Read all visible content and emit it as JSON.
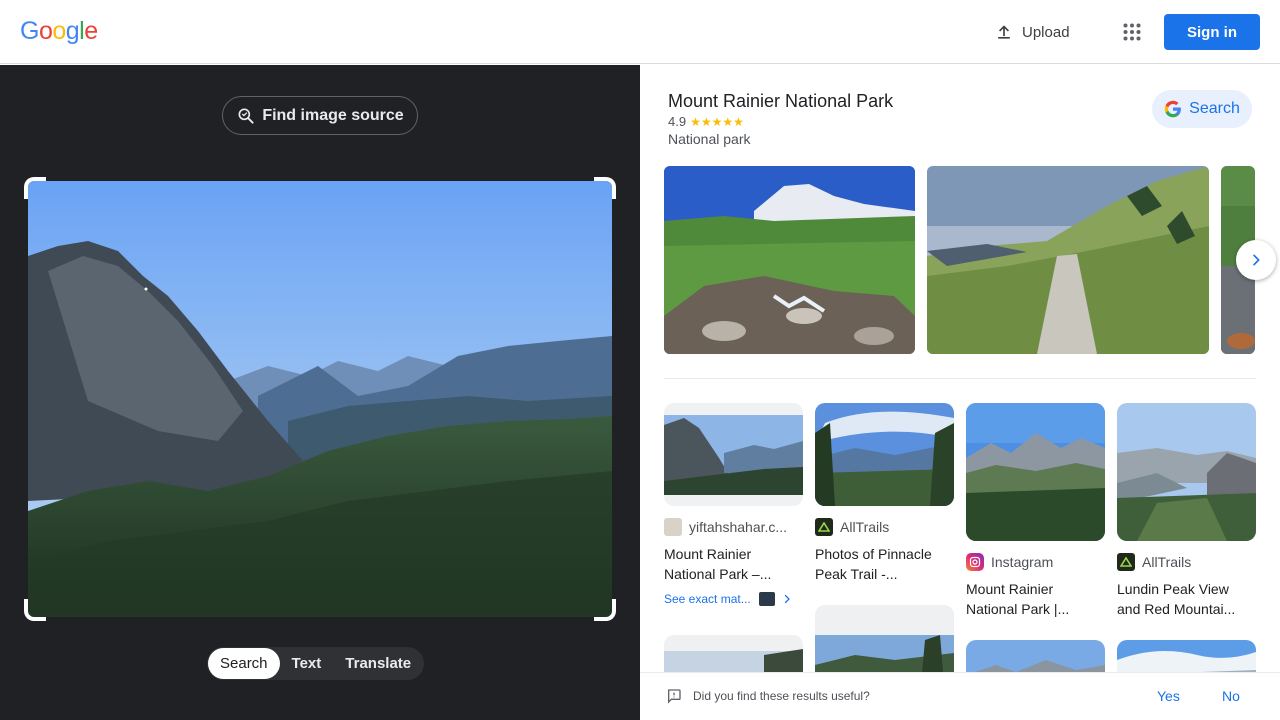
{
  "header": {
    "logo_letters": [
      {
        "ch": "G",
        "color": "#4285f4"
      },
      {
        "ch": "o",
        "color": "#ea4335"
      },
      {
        "ch": "o",
        "color": "#fbbc05"
      },
      {
        "ch": "g",
        "color": "#4285f4"
      },
      {
        "ch": "l",
        "color": "#34a853"
      },
      {
        "ch": "e",
        "color": "#ea4335"
      }
    ],
    "upload_label": "Upload",
    "apps_icon": "apps-grid-icon",
    "signin_label": "Sign in",
    "accent": "#1a73e8"
  },
  "left_panel": {
    "find_source_label": "Find image source",
    "modes": [
      {
        "label": "Search",
        "active": true
      },
      {
        "label": "Text",
        "active": false
      },
      {
        "label": "Translate",
        "active": false
      }
    ]
  },
  "knowledge_panel": {
    "title": "Mount Rainier National Park",
    "rating": "4.9",
    "stars": "★★★★★",
    "type": "National park",
    "search_label": "Search"
  },
  "results": [
    {
      "source": "yiftahshahar.c...",
      "title": "Mount Rainier National Park –...",
      "exact_label": "See exact mat..."
    },
    {
      "source": "AllTrails",
      "title": "Photos of Pinnacle Peak Trail -..."
    },
    {
      "source": "Instagram",
      "title": "Mount Rainier National Park |..."
    },
    {
      "source": "AllTrails",
      "title": "Lundin Peak View and Red Mountai..."
    }
  ],
  "feedback": {
    "question": "Did you find these results useful?",
    "yes_label": "Yes",
    "no_label": "No"
  }
}
